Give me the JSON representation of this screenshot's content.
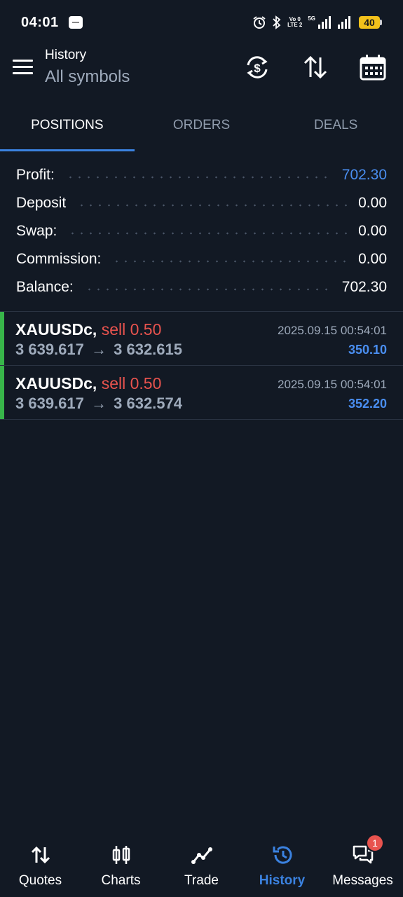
{
  "status_bar": {
    "time": "04:01",
    "volte_top": "Vo 0",
    "volte_bottom": "LTE 2",
    "net_type": "5G",
    "battery": "40"
  },
  "app_bar": {
    "title": "History",
    "subtitle": "All symbols"
  },
  "tabs": [
    {
      "label": "POSITIONS",
      "active": true
    },
    {
      "label": "ORDERS",
      "active": false
    },
    {
      "label": "DEALS",
      "active": false
    }
  ],
  "summary": [
    {
      "label": "Profit:",
      "value": "702.30"
    },
    {
      "label": "Deposit",
      "value": "0.00"
    },
    {
      "label": "Swap:",
      "value": "0.00"
    },
    {
      "label": "Commission:",
      "value": "0.00"
    },
    {
      "label": "Balance:",
      "value": "702.30"
    }
  ],
  "positions": [
    {
      "symbol": "XAUUSDc,",
      "direction": "sell 0.50",
      "open_price": "3 639.617",
      "arrow": "→",
      "close_price": "3 632.615",
      "time": "2025.09.15 00:54:01",
      "profit": "350.10"
    },
    {
      "symbol": "XAUUSDc,",
      "direction": "sell 0.50",
      "open_price": "3 639.617",
      "arrow": "→",
      "close_price": "3 632.574",
      "time": "2025.09.15 00:54:01",
      "profit": "352.20"
    }
  ],
  "bottom_nav": [
    {
      "label": "Quotes",
      "icon": "quotes-icon"
    },
    {
      "label": "Charts",
      "icon": "charts-icon"
    },
    {
      "label": "Trade",
      "icon": "trade-icon"
    },
    {
      "label": "History",
      "icon": "history-icon",
      "active": true
    },
    {
      "label": "Messages",
      "icon": "messages-icon",
      "badge": "1"
    }
  ],
  "colors": {
    "background": "#121924",
    "accent": "#3b82e0",
    "profit": "#4a8ef0",
    "sell": "#e8534e",
    "position_bar": "#38b54a"
  }
}
